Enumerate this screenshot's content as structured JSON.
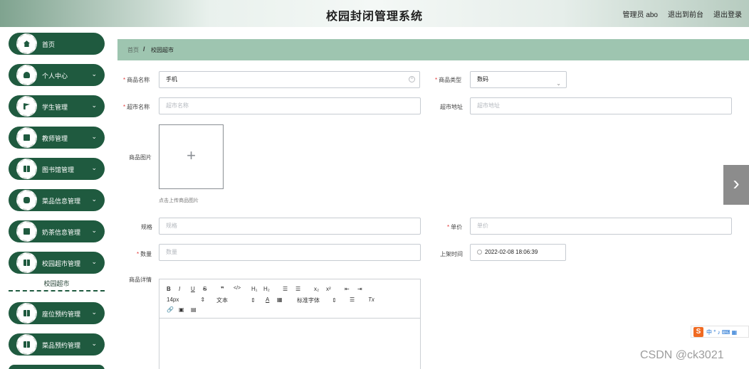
{
  "header": {
    "title": "校园封闭管理系统",
    "user": "管理员 abo",
    "back_to_front": "退出到前台",
    "logout": "退出登录"
  },
  "sidebar": {
    "items": [
      {
        "label": "首页",
        "icon": "home-icon",
        "arrow": ""
      },
      {
        "label": "个人中心",
        "icon": "user-icon",
        "arrow": "⌄"
      },
      {
        "label": "学生管理",
        "icon": "flag-icon",
        "arrow": "⌄"
      },
      {
        "label": "教师管理",
        "icon": "briefcase-icon",
        "arrow": "⌄"
      },
      {
        "label": "图书馆管理",
        "icon": "grid-icon",
        "arrow": "⌄"
      },
      {
        "label": "菜品信息管理",
        "icon": "chat-icon",
        "arrow": "⌄"
      },
      {
        "label": "奶茶信息管理",
        "icon": "book-icon",
        "arrow": "⌄"
      },
      {
        "label": "校园超市管理",
        "icon": "grid-icon",
        "arrow": "⌄"
      },
      {
        "label": "座位预约管理",
        "icon": "grid-icon",
        "arrow": "⌄"
      },
      {
        "label": "菜品预约管理",
        "icon": "grid-icon",
        "arrow": "⌄"
      }
    ],
    "active_sub": "校园超市"
  },
  "breadcrumb": {
    "home": "首页",
    "separator": "/",
    "current": "校园超市"
  },
  "form": {
    "product_name": {
      "label": "商品名称",
      "value": "手机"
    },
    "product_type": {
      "label": "商品类型",
      "value": "数码"
    },
    "market_name": {
      "label": "超市名称",
      "placeholder": "超市名称"
    },
    "market_address": {
      "label": "超市地址",
      "placeholder": "超市地址"
    },
    "product_image": {
      "label": "商品图片",
      "hint": "点击上传商品图片"
    },
    "spec": {
      "label": "规格",
      "placeholder": "规格"
    },
    "unit_price": {
      "label": "单价",
      "placeholder": "单价"
    },
    "quantity": {
      "label": "数量",
      "placeholder": "数量"
    },
    "shelf_time": {
      "label": "上架时间",
      "value": "2022-02-08 18:06:39"
    },
    "details": {
      "label": "商品详情"
    }
  },
  "editor": {
    "bold": "B",
    "italic": "I",
    "underline": "U",
    "strike": "S",
    "quote": "❞",
    "code": "</>",
    "h1": "H₁",
    "h2": "H₂",
    "ordered_list": "☰",
    "bullet_list": "☰",
    "subscript": "x₂",
    "superscript": "x²",
    "outdent": "⇤",
    "indent": "⇥",
    "font_size": "14px",
    "text_style": "文本",
    "font_family": "标准字体",
    "color_a": "A",
    "align": "☰",
    "clear_format": "Tx"
  },
  "ime": {
    "brand": "S",
    "text": "中 ° ♪ ⌨ ▦"
  },
  "watermark": "CSDN @ck3021",
  "colors": {
    "sidebar": "#1f5a3f",
    "crumb": "#9ec5b0",
    "required": "#e23b3b"
  }
}
